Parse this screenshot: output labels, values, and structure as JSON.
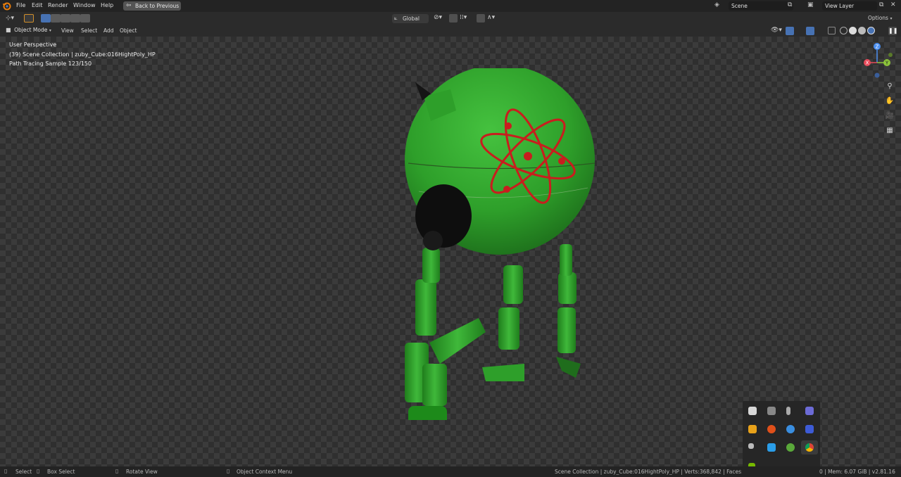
{
  "menubar": {
    "items": [
      "File",
      "Edit",
      "Render",
      "Window",
      "Help"
    ],
    "back_label": "Back to Previous",
    "scene_name": "Scene",
    "view_layer": "View Layer"
  },
  "toolbar": {
    "orientation": "Global",
    "options_label": "Options"
  },
  "header": {
    "mode": "Object Mode",
    "menus": [
      "View",
      "Select",
      "Add",
      "Object"
    ]
  },
  "overlay": {
    "perspective": "User Perspective",
    "collection": "(39) Scene Collection | zuby_Cube:016HightPoly_HP",
    "render_progress": "Path Tracing Sample 123/150"
  },
  "gizmo": {
    "x": "X",
    "y": "Y",
    "z": "Z"
  },
  "statusbar": {
    "select": "Select",
    "box_select": "Box Select",
    "rotate": "Rotate View",
    "context_menu": "Object Context Menu",
    "stats": "Scene Collection | zuby_Cube:016HightPoly_HP | Verts:368,842 | Faces:364,4",
    "memory": "0 | Mem: 6.07 GiB | v2.81.16"
  },
  "colors": {
    "robot_green": "#2e9f2a",
    "atom_red": "#c81e1e",
    "accent_blue": "#4772b3"
  }
}
